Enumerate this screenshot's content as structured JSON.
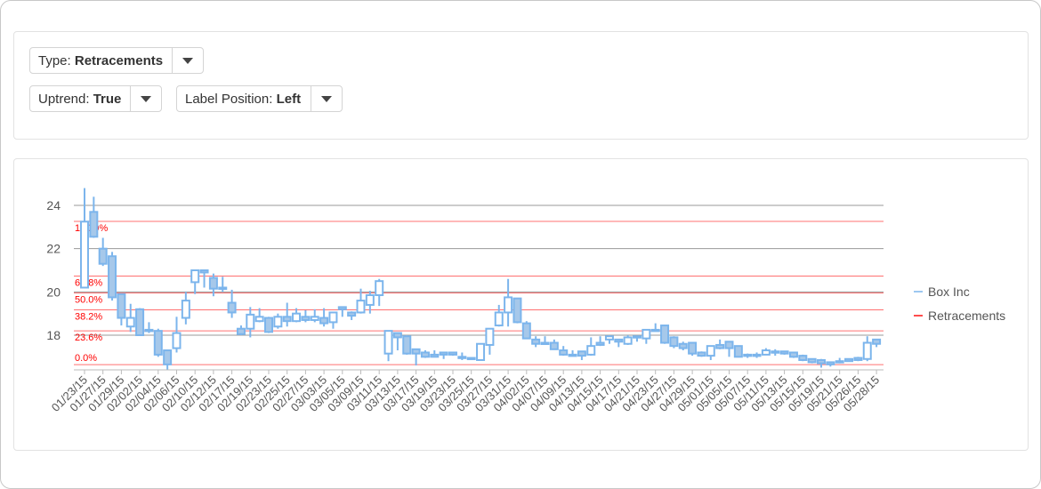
{
  "controls": {
    "type": {
      "label": "Type: ",
      "value": "Retracements"
    },
    "uptrend": {
      "label": "Uptrend: ",
      "value": "True"
    },
    "label_position": {
      "label": "Label Position: ",
      "value": "Left"
    }
  },
  "chart_data": {
    "type": "candlestick",
    "title": "",
    "xlabel": "",
    "ylabel": "",
    "ylim": [
      16.4,
      24.9
    ],
    "y_ticks": [
      18,
      20,
      22,
      24
    ],
    "grid": true,
    "legend_position": "right",
    "colors": {
      "candle": "#7cb5ec",
      "candle_fill": "#a6c8ea",
      "retracement": "#ff4d4d",
      "grid": "#999999",
      "fib_label": "#ff0000"
    },
    "legend": [
      {
        "name": "Box Inc",
        "color": "#7cb5ec"
      },
      {
        "name": "Retracements",
        "color": "#ff4d4d"
      }
    ],
    "x_tick_labels": [
      "01/23/15",
      "01/27/15",
      "01/29/15",
      "02/02/15",
      "02/04/15",
      "02/06/15",
      "02/10/15",
      "02/12/15",
      "02/17/15",
      "02/19/15",
      "02/23/15",
      "02/25/15",
      "02/27/15",
      "03/03/15",
      "03/05/15",
      "03/09/15",
      "03/11/15",
      "03/13/15",
      "03/17/15",
      "03/19/15",
      "03/23/15",
      "03/25/15",
      "03/27/15",
      "03/31/15",
      "04/02/15",
      "04/07/15",
      "04/09/15",
      "04/13/15",
      "04/15/15",
      "04/17/15",
      "04/21/15",
      "04/23/15",
      "04/27/15",
      "04/29/15",
      "05/01/15",
      "05/05/15",
      "05/07/15",
      "05/11/15",
      "05/13/15",
      "05/15/15",
      "05/19/15",
      "05/21/15",
      "05/26/15",
      "05/28/15"
    ],
    "series_name": "Box Inc",
    "ohlc": [
      [
        20.2,
        24.8,
        20.2,
        23.25
      ],
      [
        23.7,
        24.4,
        22.5,
        22.55
      ],
      [
        22.0,
        22.5,
        21.2,
        21.3
      ],
      [
        21.65,
        21.85,
        19.6,
        19.75
      ],
      [
        19.9,
        19.9,
        18.45,
        18.8
      ],
      [
        18.4,
        19.45,
        18.15,
        18.8
      ],
      [
        19.2,
        19.25,
        18.0,
        18.0
      ],
      [
        18.25,
        18.6,
        18.1,
        18.2
      ],
      [
        18.2,
        18.3,
        17.0,
        17.1
      ],
      [
        17.3,
        17.3,
        16.4,
        16.65
      ],
      [
        17.4,
        18.85,
        17.2,
        18.1
      ],
      [
        18.8,
        20.0,
        18.5,
        19.6
      ],
      [
        20.45,
        21.0,
        19.9,
        21.0
      ],
      [
        21.0,
        21.0,
        20.2,
        20.9
      ],
      [
        20.65,
        20.85,
        19.8,
        20.15
      ],
      [
        20.2,
        20.7,
        20.0,
        20.2
      ],
      [
        19.5,
        20.1,
        18.8,
        19.05
      ],
      [
        18.3,
        18.45,
        18.0,
        18.05
      ],
      [
        18.3,
        19.3,
        17.9,
        18.95
      ],
      [
        18.65,
        19.25,
        18.6,
        18.85
      ],
      [
        18.8,
        18.85,
        18.1,
        18.15
      ],
      [
        18.4,
        19.0,
        18.3,
        18.85
      ],
      [
        18.85,
        19.5,
        18.4,
        18.65
      ],
      [
        18.65,
        19.25,
        18.6,
        19.0
      ],
      [
        18.85,
        19.15,
        18.6,
        18.7
      ],
      [
        18.7,
        19.2,
        18.6,
        18.85
      ],
      [
        18.8,
        19.25,
        18.4,
        18.55
      ],
      [
        18.6,
        19.05,
        18.3,
        19.05
      ],
      [
        19.3,
        19.3,
        18.85,
        19.2
      ],
      [
        19.05,
        19.1,
        18.7,
        18.9
      ],
      [
        19.05,
        20.15,
        19.0,
        19.6
      ],
      [
        19.4,
        20.05,
        19.0,
        19.85
      ],
      [
        19.85,
        20.6,
        19.35,
        20.5
      ],
      [
        17.15,
        18.2,
        16.8,
        18.2
      ],
      [
        18.1,
        18.1,
        17.3,
        17.9
      ],
      [
        17.95,
        18.0,
        17.1,
        17.15
      ],
      [
        17.35,
        17.35,
        16.6,
        17.15
      ],
      [
        17.2,
        17.3,
        16.95,
        17.0
      ],
      [
        17.1,
        17.3,
        17.0,
        17.0
      ],
      [
        17.2,
        17.2,
        16.9,
        17.1
      ],
      [
        17.2,
        17.2,
        17.05,
        17.1
      ],
      [
        17.0,
        17.2,
        16.85,
        17.0
      ],
      [
        16.95,
        16.95,
        16.85,
        16.9
      ],
      [
        16.85,
        17.6,
        16.85,
        17.6
      ],
      [
        17.55,
        18.3,
        17.1,
        18.3
      ],
      [
        18.45,
        19.4,
        18.4,
        19.05
      ],
      [
        19.05,
        20.6,
        18.4,
        19.75
      ],
      [
        19.7,
        19.7,
        18.55,
        18.6
      ],
      [
        18.55,
        18.65,
        17.85,
        17.85
      ],
      [
        17.8,
        17.95,
        17.45,
        17.6
      ],
      [
        17.65,
        17.95,
        17.55,
        17.6
      ],
      [
        17.65,
        17.8,
        17.35,
        17.35
      ],
      [
        17.3,
        17.5,
        17.05,
        17.1
      ],
      [
        17.1,
        17.3,
        17.05,
        17.05
      ],
      [
        17.25,
        17.25,
        16.85,
        17.05
      ],
      [
        17.1,
        17.9,
        17.05,
        17.5
      ],
      [
        17.65,
        17.95,
        17.5,
        17.55
      ],
      [
        17.8,
        18.0,
        17.6,
        17.95
      ],
      [
        17.8,
        17.8,
        17.45,
        17.7
      ],
      [
        17.6,
        18.0,
        17.55,
        17.9
      ],
      [
        17.95,
        17.95,
        17.7,
        17.9
      ],
      [
        17.85,
        18.25,
        17.6,
        18.25
      ],
      [
        18.25,
        18.55,
        18.2,
        18.2
      ],
      [
        18.45,
        18.45,
        17.6,
        17.65
      ],
      [
        17.9,
        17.95,
        17.4,
        17.5
      ],
      [
        17.6,
        17.7,
        17.3,
        17.4
      ],
      [
        17.65,
        17.65,
        17.05,
        17.15
      ],
      [
        17.2,
        17.25,
        17.0,
        17.05
      ],
      [
        17.05,
        17.5,
        16.85,
        17.5
      ],
      [
        17.55,
        17.8,
        17.35,
        17.4
      ],
      [
        17.7,
        17.7,
        17.0,
        17.4
      ],
      [
        17.5,
        17.5,
        17.0,
        17.0
      ],
      [
        17.1,
        17.15,
        16.95,
        17.05
      ],
      [
        17.1,
        17.2,
        16.95,
        17.1
      ],
      [
        17.1,
        17.4,
        17.1,
        17.3
      ],
      [
        17.25,
        17.35,
        17.05,
        17.25
      ],
      [
        17.25,
        17.25,
        17.1,
        17.15
      ],
      [
        17.2,
        17.2,
        16.95,
        17.0
      ],
      [
        17.05,
        17.1,
        16.8,
        16.85
      ],
      [
        16.9,
        16.9,
        16.7,
        16.75
      ],
      [
        16.85,
        16.9,
        16.5,
        16.7
      ],
      [
        16.75,
        16.75,
        16.55,
        16.65
      ],
      [
        16.8,
        16.95,
        16.7,
        16.8
      ],
      [
        16.9,
        16.9,
        16.8,
        16.8
      ],
      [
        16.95,
        17.0,
        16.8,
        16.85
      ],
      [
        16.9,
        17.95,
        16.8,
        17.65
      ],
      [
        17.8,
        17.8,
        17.45,
        17.6
      ]
    ],
    "retracements": {
      "uptrend": true,
      "high": 23.26,
      "low": 16.64,
      "levels": [
        {
          "ratio": 1.0,
          "label": "100.0%"
        },
        {
          "ratio": 0.618,
          "label": "61.8%"
        },
        {
          "ratio": 0.5,
          "label": "50.0%"
        },
        {
          "ratio": 0.382,
          "label": "38.2%"
        },
        {
          "ratio": 0.236,
          "label": "23.6%"
        },
        {
          "ratio": 0.0,
          "label": "0.0%"
        }
      ]
    }
  }
}
